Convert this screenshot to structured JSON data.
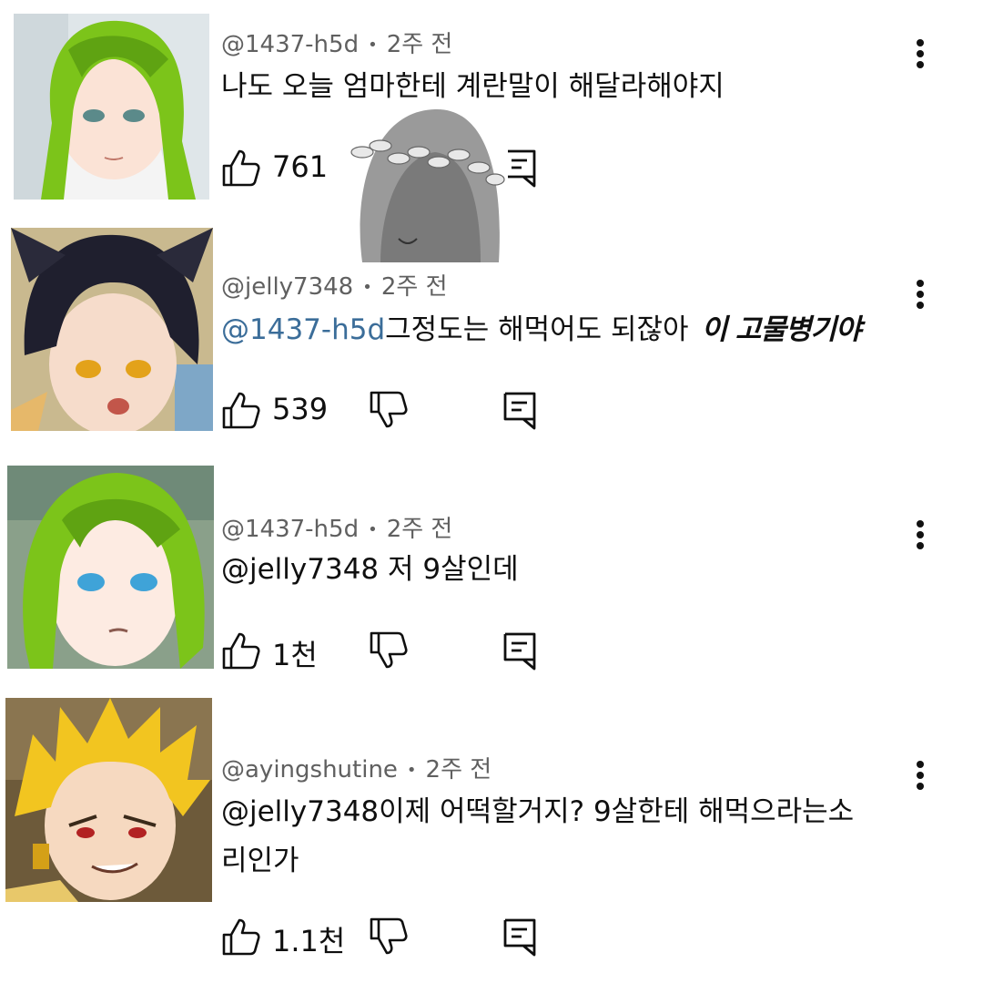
{
  "comments": [
    {
      "author": "@1437-h5d",
      "time": "2주 전",
      "mention": "",
      "text": "나도 오늘 엄마한테 계란말이 해달라해야지",
      "likes": "761"
    },
    {
      "author": "@jelly7348",
      "time": "2주 전",
      "mention": "@1437-h5d",
      "text": "그정도는 해먹어도 되잖아",
      "handwritten_note": "이 고물병기야",
      "likes": "539"
    },
    {
      "author": "@1437-h5d",
      "time": "2주 전",
      "mention": "",
      "text": "@jelly7348 저 9살인데",
      "likes": "1천"
    },
    {
      "author": "@ayingshutine",
      "time": "2주 전",
      "mention": "",
      "text_line1": "@jelly7348이제 어떡할거지? 9살한테 해먹으라는소",
      "text_line2": "리인가",
      "likes": "1.1천"
    }
  ],
  "icons": {
    "like": "thumbs-up-icon",
    "dislike": "thumbs-down-icon",
    "reply": "reply-comment-icon",
    "more": "more-vert-icon"
  },
  "colors": {
    "mention": "#3b6d99",
    "meta": "#606060",
    "green_hair": "#7cc41a",
    "gold_hair": "#f2c520"
  }
}
